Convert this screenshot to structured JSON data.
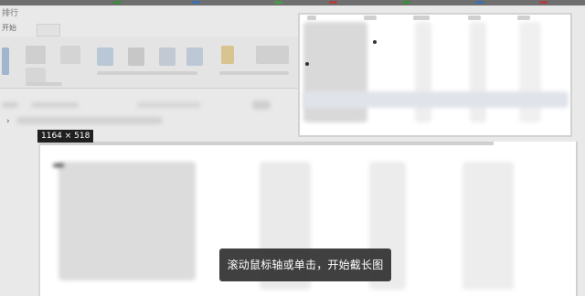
{
  "app": {
    "title": "排行",
    "ribbon_tab_first": "开始"
  },
  "capture": {
    "size_label": "1164 × 518",
    "toast_text": "滚动鼠标轴或单击，开始截长图"
  },
  "colors": {
    "toast_bg": "#303030",
    "size_label_bg": "#202020",
    "preview_bg": "#ffffff",
    "dimmed_bg": "#e9e9e9"
  }
}
